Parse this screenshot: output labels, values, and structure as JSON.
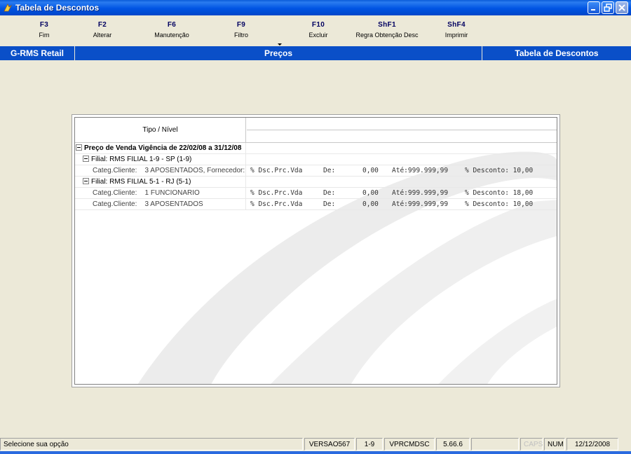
{
  "window": {
    "title": "Tabela de Descontos"
  },
  "fkeys": [
    {
      "key": "F3",
      "label": "Fim"
    },
    {
      "key": "F2",
      "label": "Alterar"
    },
    {
      "key": "F6",
      "label": "Manutenção"
    },
    {
      "key": "F9",
      "label": "Filtro"
    },
    {
      "key": "F10",
      "label": "Excluir"
    },
    {
      "key": "ShF1",
      "label": "Regra Obtenção Desc"
    },
    {
      "key": "ShF4",
      "label": "Imprimir"
    }
  ],
  "modbar": {
    "left": "G-RMS Retail",
    "center": "Preços",
    "right": "Tabela de Descontos"
  },
  "grid": {
    "header": "Tipo / Nível",
    "rows": [
      {
        "text": "Preço de Venda Vigência de 22/02/08 a 31/12/08"
      },
      {
        "text": "Filial: RMS FILIAL 1-9 - SP  (1-9)"
      },
      {
        "label": "Categ.Cliente:",
        "value": "3  APOSENTADOS, Fornecedor:",
        "tipo": "% Dsc.Prc.Vda",
        "de_label": "De:",
        "de": "0,00",
        "ate": "Até:999.999,99",
        "desc": "% Desconto: 10,00"
      },
      {
        "text": "Filial: RMS FILIAL 5-1 - RJ  (5-1)"
      },
      {
        "label": "Categ.Cliente:",
        "value": "1  FUNCIONARIO",
        "tipo": "% Dsc.Prc.Vda",
        "de_label": "De:",
        "de": "0,00",
        "ate": "Até:999.999,99",
        "desc": "% Desconto: 18,00"
      },
      {
        "label": "Categ.Cliente:",
        "value": "3  APOSENTADOS",
        "tipo": "% Dsc.Prc.Vda",
        "de_label": "De:",
        "de": "0,00",
        "ate": "Até:999.999,99",
        "desc": "% Desconto: 10,00"
      }
    ]
  },
  "status": {
    "message": "Selecione sua opção",
    "version": "VERSAO567",
    "filial": "1-9",
    "program": "VPRCMDSC",
    "release": "5.66.6",
    "caps": "CAPS",
    "num": "NUM",
    "date": "12/12/2008"
  }
}
